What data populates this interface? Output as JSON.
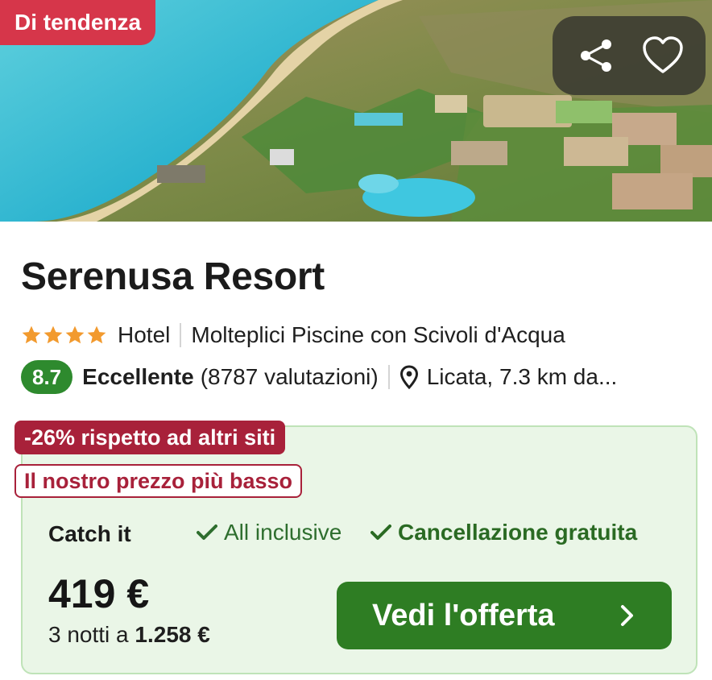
{
  "hero": {
    "badge": "Di tendenza",
    "share_icon": "share-icon",
    "favorite_icon": "heart-icon"
  },
  "hotel": {
    "name": "Serenusa Resort",
    "stars": 4,
    "type": "Hotel",
    "highlight": "Molteplici Piscine con Scivoli d'Acqua",
    "score": "8.7",
    "rating_word": "Eccellente",
    "reviews": "(8787 valutazioni)",
    "location": "Licata, 7.3 km da..."
  },
  "offer": {
    "discount_tag": "-26% rispetto ad altri siti",
    "lowest_tag": "Il nostro prezzo più basso",
    "provider": "Catch it",
    "feature_1": "All inclusive",
    "feature_2": "Cancellazione gratuita",
    "price": "419 €",
    "nights_prefix": "3 notti a ",
    "total": "1.258 €",
    "cta_label": "Vedi l'offerta"
  },
  "colors": {
    "trend_badge": "#d6364a",
    "score_green": "#2e8a2e",
    "discount_red": "#a8213a",
    "offer_bg": "#eaf6e7",
    "cta_green": "#2e7d23",
    "star_orange": "#f29a2e"
  }
}
